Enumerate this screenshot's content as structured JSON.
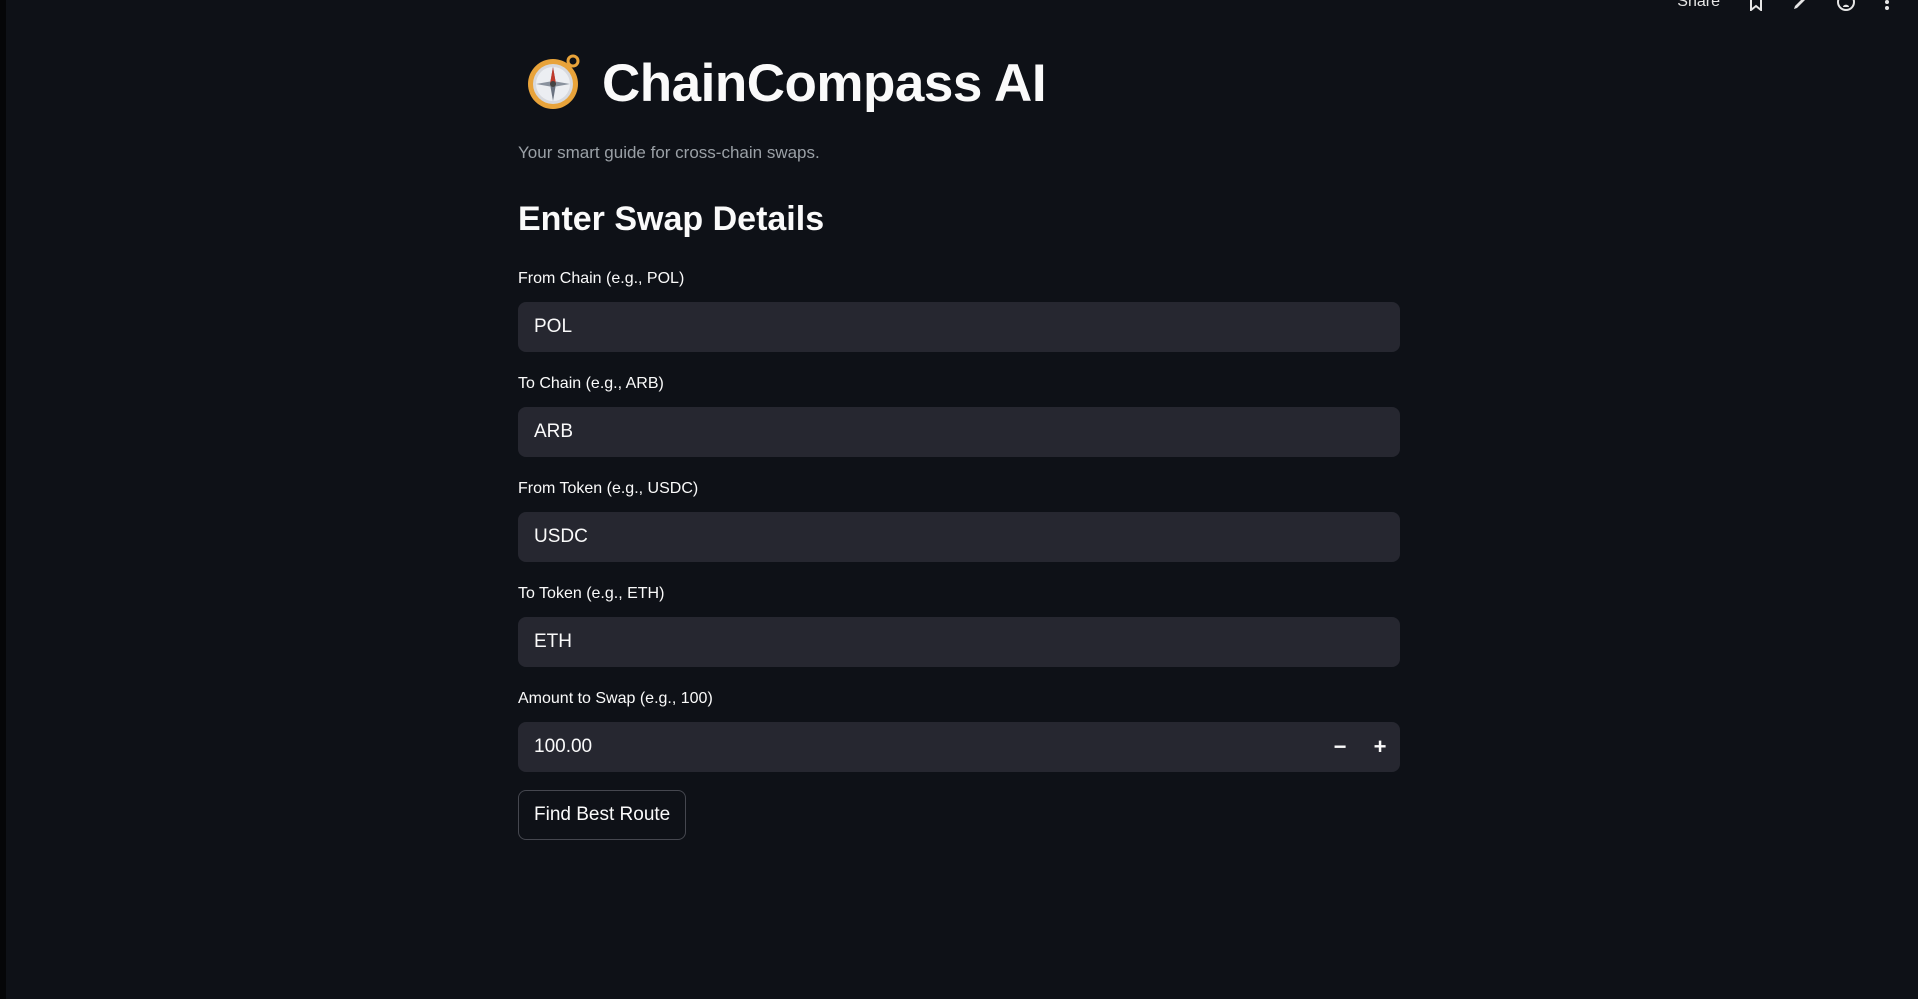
{
  "toolbar": {
    "share_label": "Share",
    "icons": [
      "star-icon",
      "edit-icon",
      "github-icon",
      "more-icon"
    ]
  },
  "app": {
    "title": "ChainCompass AI",
    "logo_icon": "compass-icon",
    "subtitle": "Your smart guide for cross-chain swaps."
  },
  "form": {
    "heading": "Enter Swap Details",
    "from_chain": {
      "label": "From Chain (e.g., POL)",
      "value": "POL"
    },
    "to_chain": {
      "label": "To Chain (e.g., ARB)",
      "value": "ARB"
    },
    "from_token": {
      "label": "From Token (e.g., USDC)",
      "value": "USDC"
    },
    "to_token": {
      "label": "To Token (e.g., ETH)",
      "value": "ETH"
    },
    "amount": {
      "label": "Amount to Swap (e.g., 100)",
      "value": "100.00",
      "decrement": "−",
      "increment": "+"
    },
    "submit_label": "Find Best Route"
  },
  "colors": {
    "background": "#0e1117",
    "input_background": "#262730",
    "text": "#fafafa",
    "muted_text": "#9aa0a6"
  }
}
